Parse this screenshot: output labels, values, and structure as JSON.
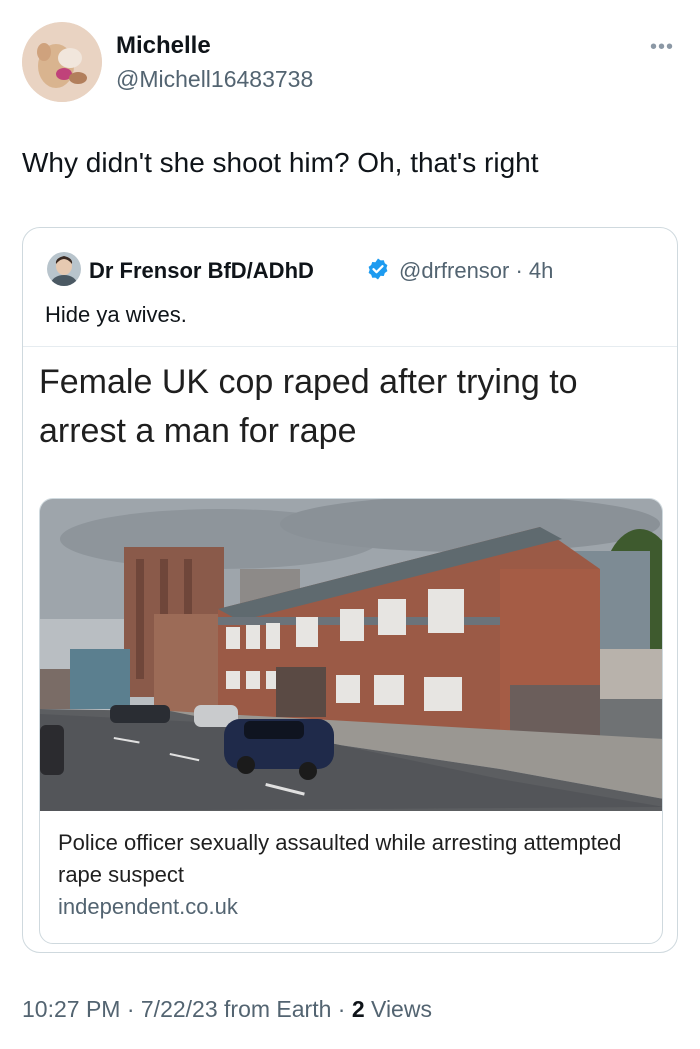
{
  "author": {
    "name": "Michelle",
    "handle": "@Michell16483738",
    "avatar_icon": "avatar-photo"
  },
  "more_icon": "more-horizontal-icon",
  "more_glyph": "•••",
  "tweet": {
    "text": "Why didn't she shoot him? Oh, that's right"
  },
  "quoted": {
    "name": "Dr Frensor BfD/ADhD",
    "handle": "@drfrensor · 4h",
    "verified_icon": "verified-badge-icon",
    "verified_color": "#1d9bf0",
    "text": "Hide ya wives.",
    "headline": "Female UK cop raped after trying to arrest a man for rape",
    "card": {
      "title": "Police officer sexually assaulted while arresting attempted rape suspect",
      "domain": "independent.co.uk"
    }
  },
  "meta": {
    "timestamp": "10:27 PM · 7/22/23 from Earth · ",
    "views_count": "2",
    "views_label": " Views"
  }
}
